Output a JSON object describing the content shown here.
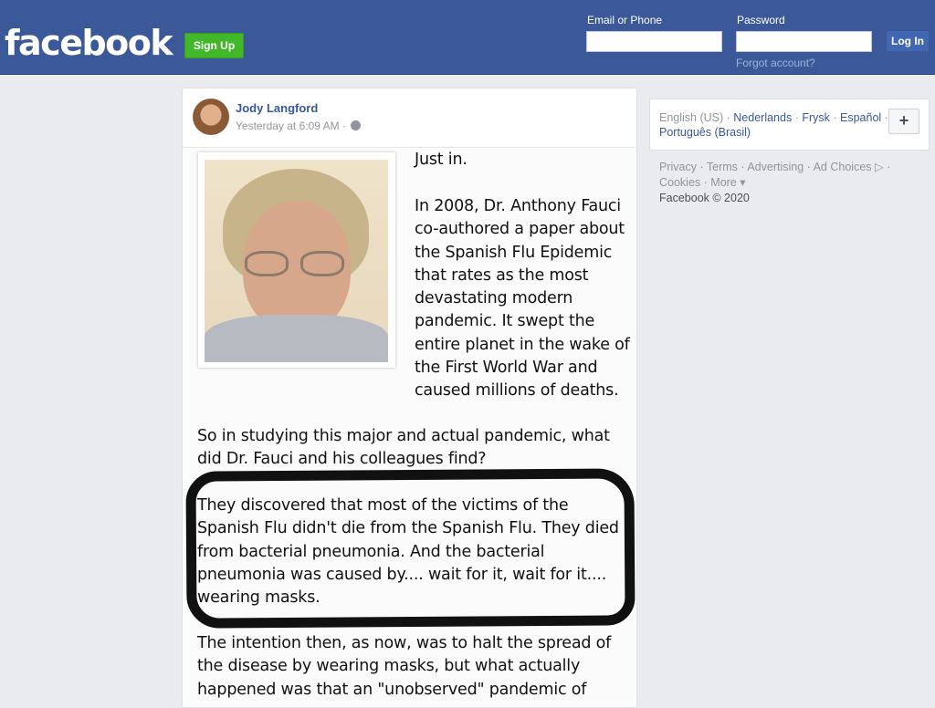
{
  "header": {
    "logo": "facebook",
    "signup_label": "Sign Up",
    "email_label": "Email or Phone",
    "password_label": "Password",
    "login_label": "Log In",
    "forgot_label": "Forgot account?"
  },
  "post": {
    "author": "Jody Langford",
    "time": "Yesterday at 6:09 AM ·",
    "privacy_icon": "globe-icon",
    "image_text": {
      "intro": "Just in.",
      "right_paragraph": "In 2008, Dr. Anthony Fauci co-authored a paper about the Spanish Flu Epidemic that rates as the most devastating modern pandemic. It swept the entire planet in the wake of the First World War and caused millions of deaths.",
      "question": "So in studying this major and actual pandemic, what did Dr. Fauci and his colleagues find?",
      "highlighted": "They discovered that most of the victims of the Spanish Flu didn't die from the Spanish Flu. They died from bacterial pneumonia. And the bacterial pneumonia was caused by.... wait for it, wait for it.... wearing masks.",
      "continuation": "The intention then, as now, was to halt the spread of the disease by wearing masks, but what actually happened was that an \"unobserved\" pandemic of"
    }
  },
  "sidebar": {
    "current_language": "English (US)",
    "languages": [
      "Nederlands",
      "Frysk",
      "Español",
      "Português (Brasil)"
    ],
    "add_label": "+",
    "footer_links": [
      "Privacy",
      "Terms",
      "Advertising",
      "Ad Choices",
      "Cookies",
      "More"
    ],
    "copyright": "Facebook © 2020"
  },
  "colors": {
    "brand": "#3b5998",
    "signup": "#42b72a",
    "link": "#365899"
  }
}
